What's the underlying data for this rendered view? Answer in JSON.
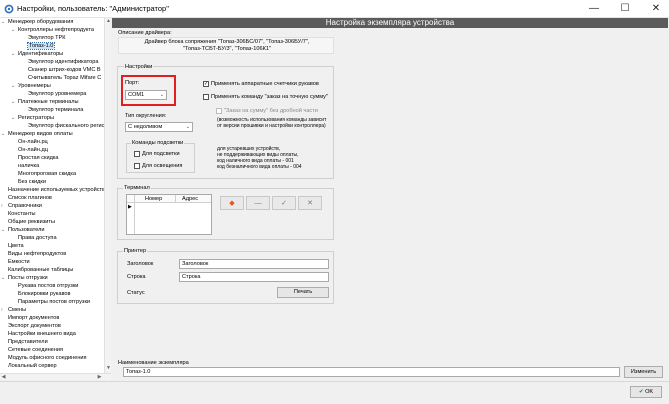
{
  "window": {
    "title": "Настройки, пользователь: \"Администратор\"",
    "minimize": "—",
    "maximize": "☐",
    "close": "✕"
  },
  "tree": {
    "items": [
      {
        "label": "Менеджер оборудования",
        "toggle": "⌄"
      },
      {
        "label": "Контроллеры нефтепродукта",
        "toggle": "⌄"
      },
      {
        "label": "Эмулятор ТРК",
        "toggle": ""
      },
      {
        "label": "Топаз-1.0",
        "toggle": ""
      },
      {
        "label": "Идентификаторы",
        "toggle": "⌄"
      },
      {
        "label": "Эмулятор идентификатора",
        "toggle": ""
      },
      {
        "label": "Сканер штрих-кодов VMC B",
        "toggle": ""
      },
      {
        "label": "Считыватель Topaz Mifare C",
        "toggle": ""
      },
      {
        "label": "Уровнемеры",
        "toggle": "⌄"
      },
      {
        "label": "Эмулятор уровнемера",
        "toggle": ""
      },
      {
        "label": "Платежные терминалы",
        "toggle": "⌄"
      },
      {
        "label": "Эмулятор терминала",
        "toggle": ""
      },
      {
        "label": "Регистраторы",
        "toggle": "⌄"
      },
      {
        "label": "Эмулятор фискального регис",
        "toggle": ""
      },
      {
        "label": "Менеджер видов оплаты",
        "toggle": "⌄"
      },
      {
        "label": "Он-лайн.рц",
        "toggle": ""
      },
      {
        "label": "Он-лайн.дц",
        "toggle": ""
      },
      {
        "label": "Простая скидка",
        "toggle": ""
      },
      {
        "label": "наличка",
        "toggle": ""
      },
      {
        "label": "Многопроговая скидка",
        "toggle": ""
      },
      {
        "label": "Без скидки",
        "toggle": ""
      },
      {
        "label": "Назначение используемых устройств",
        "toggle": ""
      },
      {
        "label": "Список плагинов",
        "toggle": ""
      },
      {
        "label": "Справочники",
        "toggle": "›"
      },
      {
        "label": "Константы",
        "toggle": ""
      },
      {
        "label": "Общие реквизиты",
        "toggle": ""
      },
      {
        "label": "Пользователи",
        "toggle": "⌄"
      },
      {
        "label": "Права доступа",
        "toggle": ""
      },
      {
        "label": "Цвета",
        "toggle": ""
      },
      {
        "label": "Виды нефтепродуктов",
        "toggle": ""
      },
      {
        "label": "Емкости",
        "toggle": ""
      },
      {
        "label": "Калиброванные таблицы",
        "toggle": ""
      },
      {
        "label": "Посты отгрузки",
        "toggle": "⌄"
      },
      {
        "label": "Рукава постов отгрузки",
        "toggle": ""
      },
      {
        "label": "Блокировки рукавов",
        "toggle": ""
      },
      {
        "label": "Параметры постов отгрузки",
        "toggle": ""
      },
      {
        "label": "Смены",
        "toggle": "›"
      },
      {
        "label": "Импорт документов",
        "toggle": ""
      },
      {
        "label": "Экспорт документов",
        "toggle": ""
      },
      {
        "label": "Настройки внешнего вида",
        "toggle": ""
      },
      {
        "label": "Представители",
        "toggle": ""
      },
      {
        "label": "Сетевые соединения",
        "toggle": ""
      },
      {
        "label": "Модуль офисного соединения",
        "toggle": ""
      },
      {
        "label": "Локальный сервер",
        "toggle": ""
      }
    ]
  },
  "panel": {
    "header": "Настройка экземпляра устройства",
    "driver_desc_label": "Описание драйвера:",
    "driver_desc_lines": [
      "Драйвер блока сопряжения \"Топаз-306БС/07\", \"Топаз-306БУ/7\",",
      "\"Топаз-ТСБТ-БУ/3\", \"Топаз-106К1\""
    ],
    "settings_label": "Настройки",
    "port_label": "Порт:",
    "port_value": "COM1",
    "rounding_label": "Тип округления:",
    "rounding_value": "С недоливом",
    "backlight_label": "Команды подсветки",
    "backlight_cb": "Для подсветки",
    "lighting_cb": "Для освещения",
    "hw_counters_cb": "Применять аппаратные счетчики рукавов",
    "exact_cmd_cb": "Применять команду \"заказ на точную сумму\"",
    "no_fraction_cb": "\"Заказ на сумму\" без дробной части",
    "fraction_note_1": "(возможность использования команды зависит",
    "fraction_note_2": "от версии прошивки и настройки контроллера)",
    "legacy_note": [
      "для устаревших устройств,",
      "не поддерживающих виды оплаты,",
      "код наличного вида оплаты - 001",
      "код безналичного вида оплаты - 004"
    ],
    "terminal_label": "Терминал",
    "terminal_cols": [
      "Номер",
      "Адрес"
    ],
    "terminal_btn_add": "◆",
    "terminal_btn_remove": "—",
    "terminal_btn_ok": "✓",
    "terminal_btn_cancel": "✕",
    "printer_label": "Принтер",
    "header_field_label": "Заголовок",
    "header_field_value": "Заголовок",
    "line_field_label": "Строка",
    "line_field_value": "Строка",
    "status_label": "Статус",
    "print_button": "Печать",
    "instance_name_label": "Наименование экземпляра",
    "instance_name_value": "Топаз-1.0",
    "rename_button": "Изменить",
    "ok_button": "OK"
  },
  "colors": {
    "header_bg": "#5b5b5b",
    "highlight": "#e02020",
    "add_icon": "#e8541c"
  }
}
